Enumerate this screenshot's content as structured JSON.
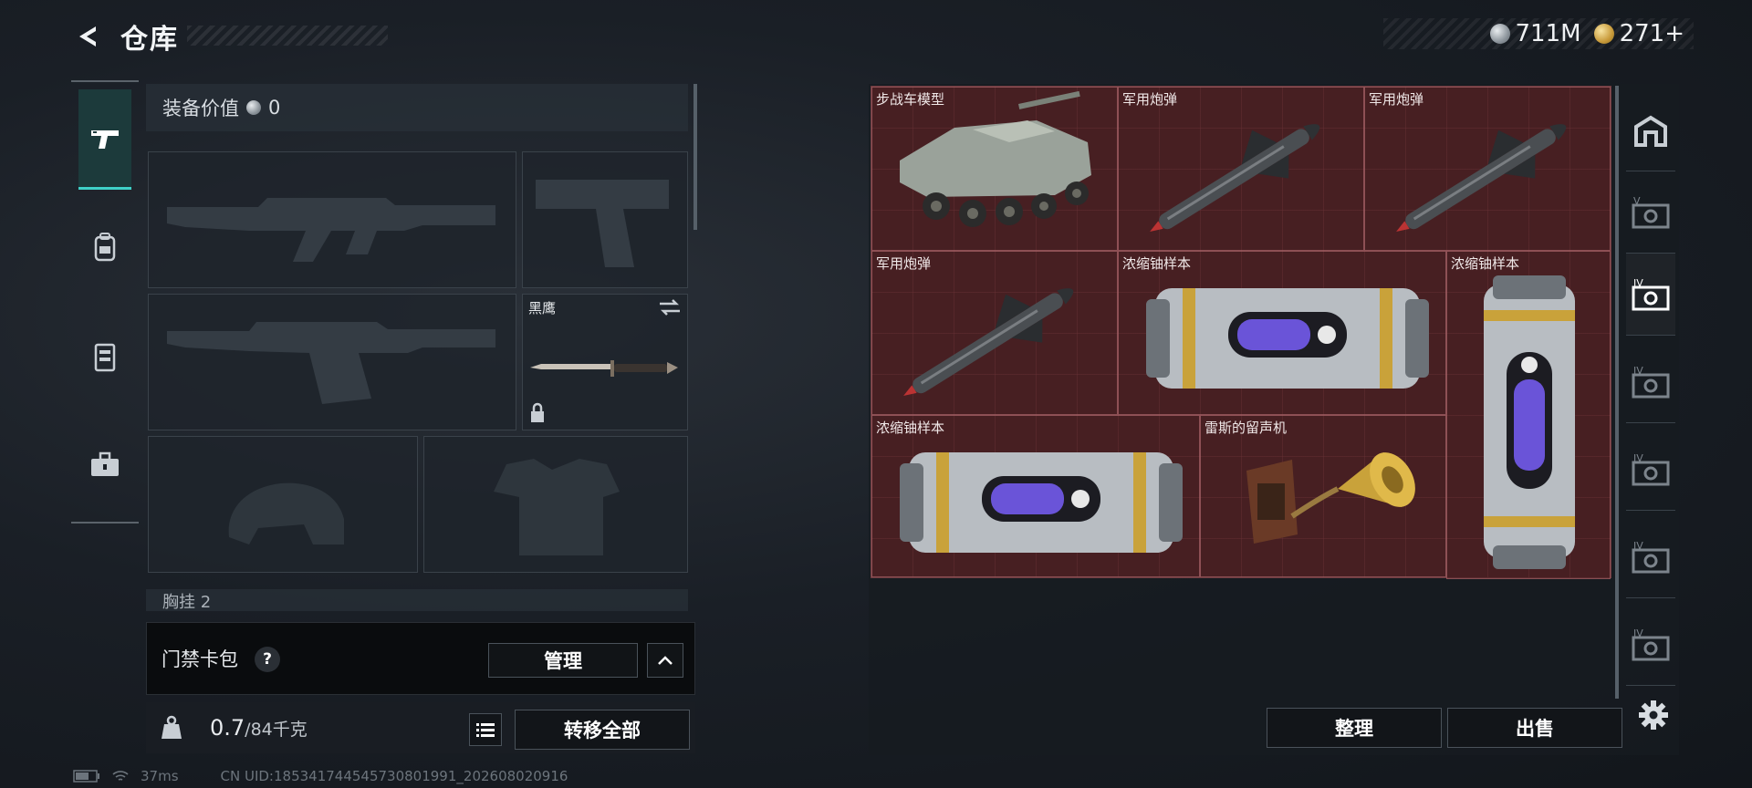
{
  "header": {
    "title": "仓库",
    "currencies": [
      {
        "icon": "silver-coin-icon",
        "value": "711M"
      },
      {
        "icon": "gold-coin-icon",
        "value": "271+"
      }
    ]
  },
  "left_nav": [
    {
      "icon": "pistol-icon",
      "active": true
    },
    {
      "icon": "backpack-icon",
      "active": false
    },
    {
      "icon": "vest-icon",
      "active": false
    },
    {
      "icon": "toolbox-icon",
      "active": false
    }
  ],
  "equipment": {
    "value_label": "装备价值",
    "value": "0",
    "knife_name": "黑鹰",
    "chest_label": "胸挂 2"
  },
  "keycard": {
    "label": "门禁卡包",
    "help": "?",
    "manage_label": "管理"
  },
  "capacity": {
    "current": "0.7",
    "max": "/84千克",
    "transfer_label": "转移全部"
  },
  "status": {
    "ping": "37ms",
    "uid": "CN UID:1853417445457308019​91_202608020916"
  },
  "storage": {
    "items": [
      {
        "name": "步战车模型",
        "icon": "ifv-model-icon"
      },
      {
        "name": "军用炮弹",
        "icon": "missile-icon"
      },
      {
        "name": "军用炮弹",
        "icon": "missile-icon"
      },
      {
        "name": "军用炮弹",
        "icon": "missile-icon"
      },
      {
        "name": "浓缩铀样本",
        "icon": "uranium-canister-icon"
      },
      {
        "name": "浓缩铀样本",
        "icon": "uranium-canister-icon"
      },
      {
        "name": "浓缩铀样本",
        "icon": "uranium-canister-icon"
      },
      {
        "name": "雷斯的留声机",
        "icon": "gramophone-icon"
      }
    ],
    "sort_label": "整理",
    "sell_label": "出售"
  },
  "right_tabs": [
    {
      "icon": "storage-home-icon"
    },
    {
      "icon": "storage-tier-v-icon",
      "label": "V"
    },
    {
      "icon": "storage-tier-iv-icon",
      "label": "IV"
    },
    {
      "icon": "storage-tier-iv-icon",
      "label": "IV"
    },
    {
      "icon": "storage-tier-iv-icon",
      "label": "IV"
    },
    {
      "icon": "storage-tier-iv-icon",
      "label": "IV"
    },
    {
      "icon": "storage-tier-iv-icon",
      "label": "IV"
    }
  ],
  "colors": {
    "accent": "#3fd0c8",
    "storage_bg": "#3d1d20",
    "panel_bg": "#1e242b"
  }
}
